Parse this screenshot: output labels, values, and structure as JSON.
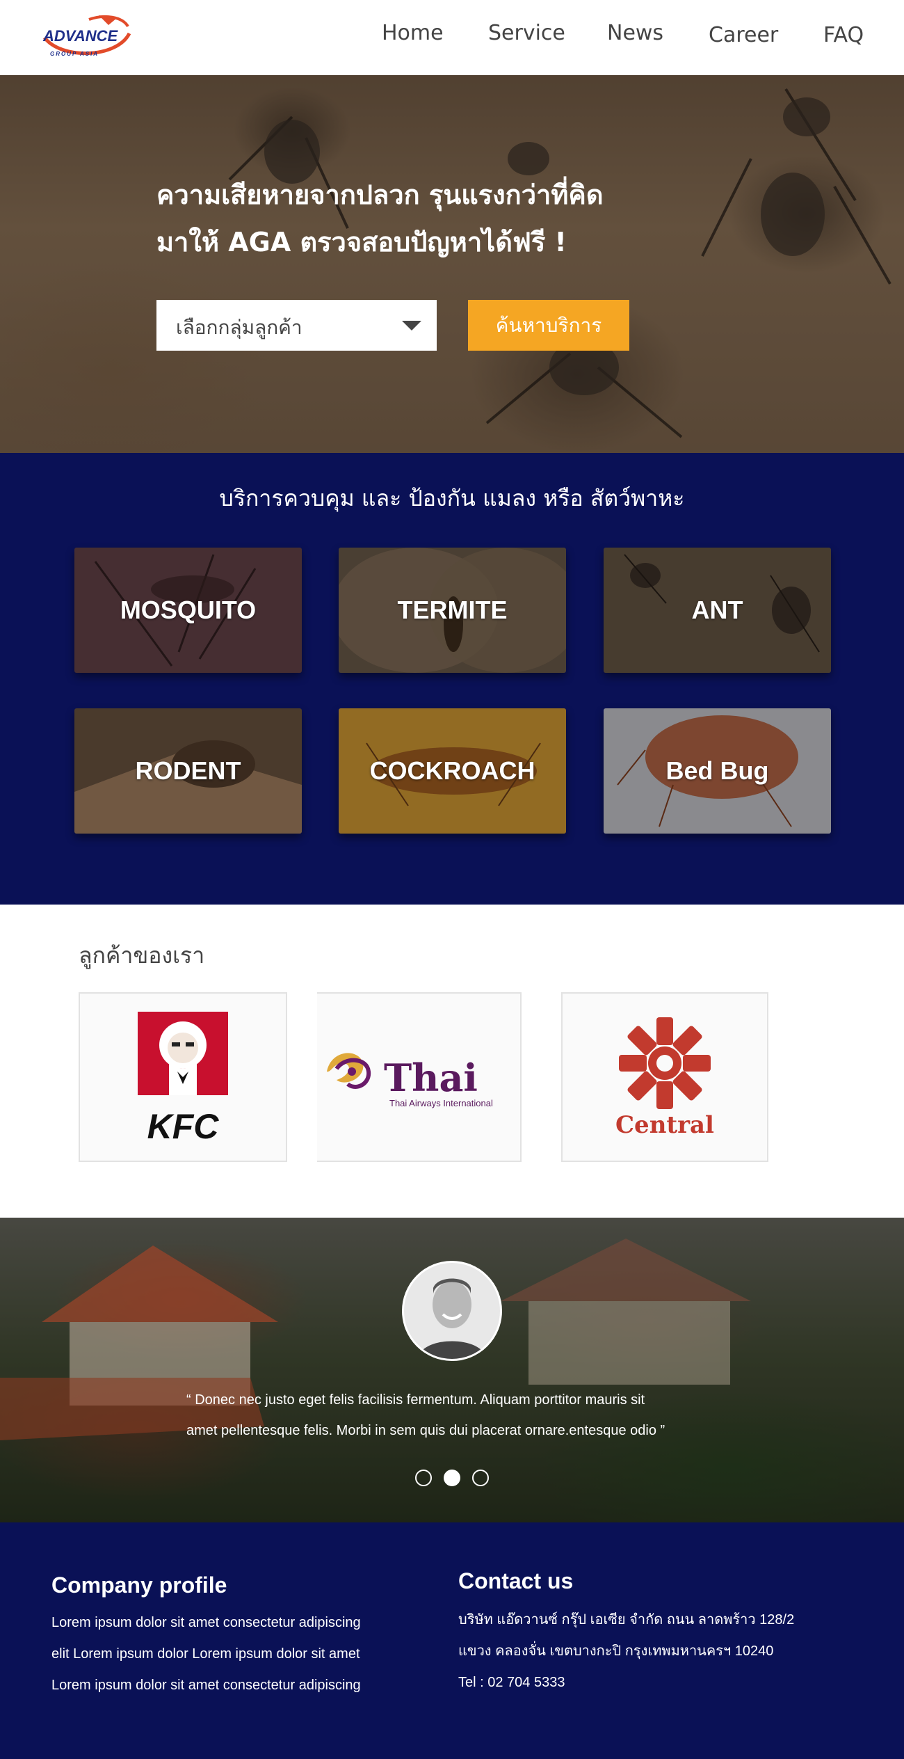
{
  "nav": {
    "logo_text": "ADVANCE",
    "logo_subtext": "GROUP ASIA",
    "links": [
      "Home",
      "Service",
      "News",
      "Career",
      "FAQ"
    ]
  },
  "hero": {
    "title_line1": "ความเสียหายจากปลวก รุนแรงกว่าที่คิด",
    "title_line2": "มาให้ AGA ตรวจสอบปัญหาได้ฟรี !",
    "select_label": "เลือกกลุ่มลูกค้า",
    "button_label": "ค้นหาบริการ"
  },
  "services": {
    "title": "บริการควบคุม และ ป้องกัน แมลง หรือ สัตว์พาหะ",
    "cards": [
      "MOSQUITO",
      "TERMITE",
      "ANT",
      "RODENT",
      "COCKROACH",
      "Bed Bug"
    ]
  },
  "clients": {
    "title": "ลูกค้าของเรา",
    "logos": [
      {
        "name": "kfc-logo",
        "text": "KFC"
      },
      {
        "name": "thai-airways-logo",
        "text": "Thai",
        "subtext": "Thai Airways International"
      },
      {
        "name": "central-logo",
        "text": "Central"
      }
    ]
  },
  "testimonial": {
    "quote_line1": "“ Donec nec justo eget felis facilisis fermentum. Aliquam porttitor mauris sit",
    "quote_line2": "amet pellentesque felis. Morbi in sem quis dui placerat ornare.entesque odio ”",
    "active_dot": 2
  },
  "footer": {
    "company_title": "Company profile",
    "company_lines": [
      "Lorem ipsum dolor sit amet consectetur adipiscing",
      "elit Lorem ipsum dolor  Lorem ipsum dolor sit amet",
      "Lorem ipsum dolor sit amet consectetur adipiscing"
    ],
    "contact_title": "Contact us",
    "contact_lines": [
      "บริษัท แอ๊ดวานซ์ กรุ๊ป เอเซีย จำกัด ถนน ลาดพร้าว 128/2",
      "แขวง คลองจั่น เขตบางกะปิ กรุงเทพมหานครฯ 10240",
      "Tel :  02 704 5333"
    ]
  },
  "colors": {
    "navy": "#0a1156",
    "accent": "#f5a623",
    "logo_blue": "#1f2f8a",
    "logo_red": "#e24b2a"
  }
}
